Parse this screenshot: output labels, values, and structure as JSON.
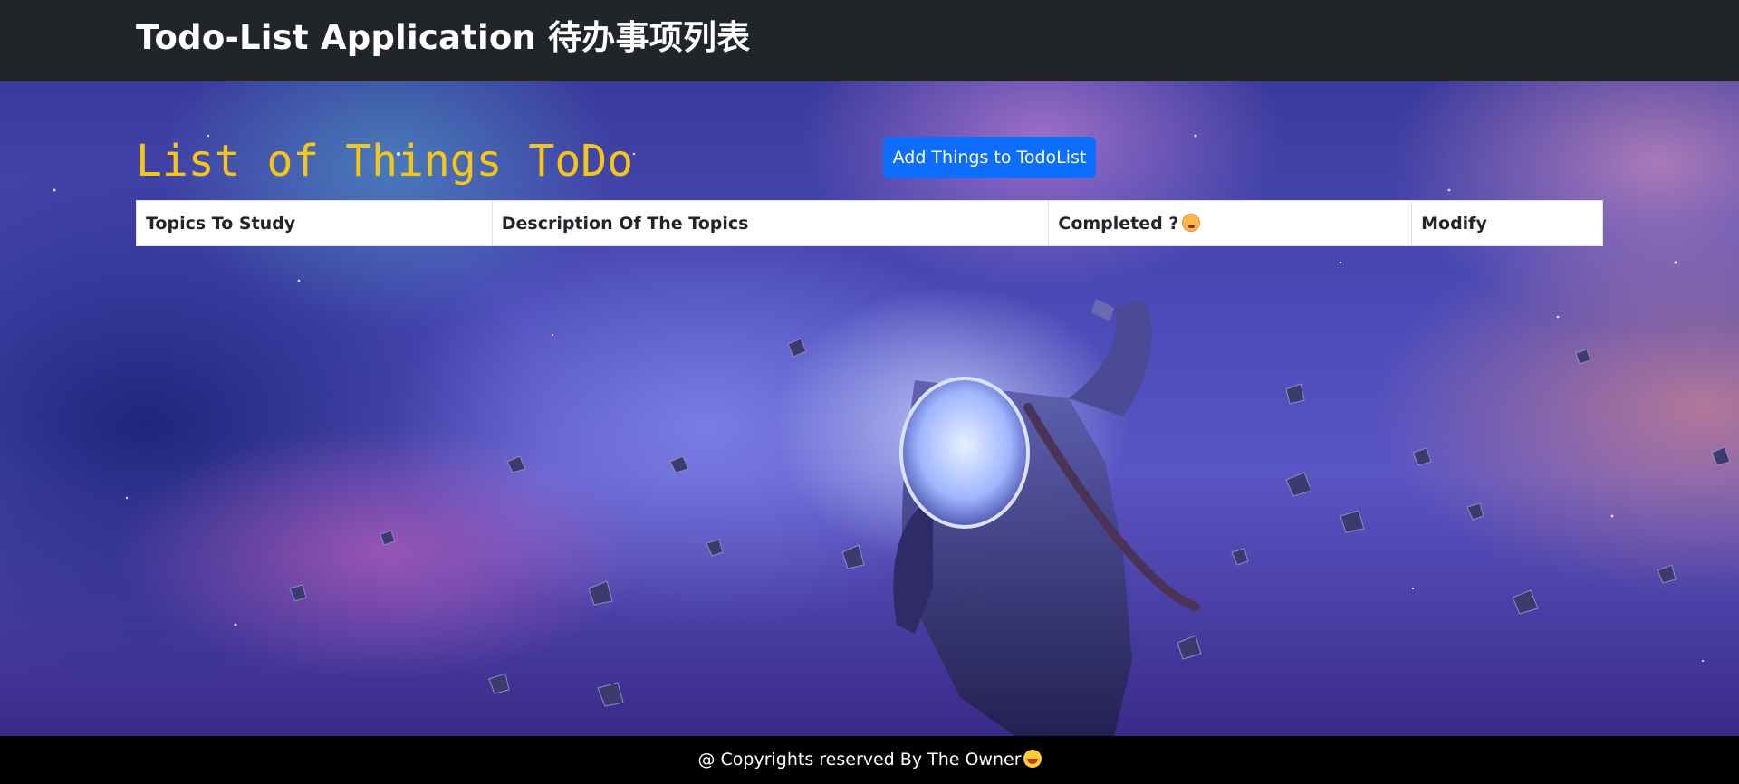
{
  "navbar": {
    "brand": "Todo-List Application 待办事项列表"
  },
  "main": {
    "title": "List of Things ToDo",
    "add_button_label": "Add Things to TodoList",
    "table": {
      "headers": [
        "Topics To Study",
        "Description Of The Topics",
        "Completed ?",
        "Modify"
      ],
      "header_icon": "thinking-face-emoji",
      "rows": []
    },
    "background_image": "astronaut-in-space-with-asteroids"
  },
  "footer": {
    "text": "@ Copyrights reserved By The Owner",
    "icon": "grinning-face-emoji"
  },
  "colors": {
    "navbar_bg": "#212529",
    "title_color": "#f5c518",
    "button_bg": "#0d6efd",
    "footer_bg": "#000000"
  }
}
